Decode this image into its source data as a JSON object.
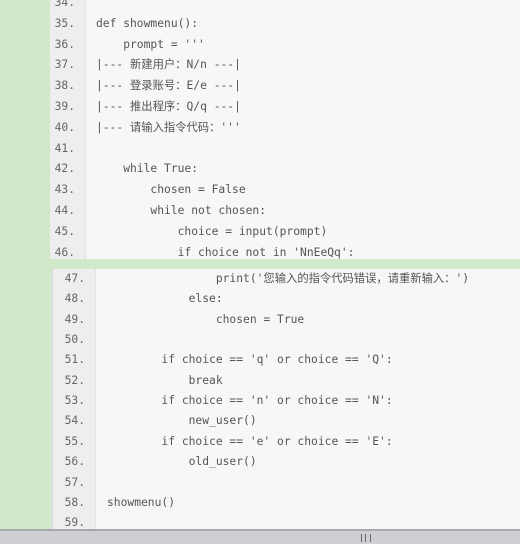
{
  "top_panel": {
    "lines": [
      {
        "n": "34.",
        "code": ""
      },
      {
        "n": "35.",
        "code": "def showmenu():"
      },
      {
        "n": "36.",
        "code": "    prompt = '''"
      },
      {
        "n": "37.",
        "code": "|--- 新建用户：N/n ---|"
      },
      {
        "n": "38.",
        "code": "|--- 登录账号：E/e ---|"
      },
      {
        "n": "39.",
        "code": "|--- 推出程序：Q/q ---|"
      },
      {
        "n": "40.",
        "code": "|--- 请输入指令代码：'''"
      },
      {
        "n": "41.",
        "code": ""
      },
      {
        "n": "42.",
        "code": "    while True:"
      },
      {
        "n": "43.",
        "code": "        chosen = False"
      },
      {
        "n": "44.",
        "code": "        while not chosen:"
      },
      {
        "n": "45.",
        "code": "            choice = input(prompt)"
      },
      {
        "n": "46.",
        "code": "            if choice not in 'NnEeQq':"
      }
    ]
  },
  "bottom_panel": {
    "lines": [
      {
        "n": "47.",
        "code": "                print('您输入的指令代码错误，请重新输入：')"
      },
      {
        "n": "48.",
        "code": "            else:"
      },
      {
        "n": "49.",
        "code": "                chosen = True"
      },
      {
        "n": "50.",
        "code": ""
      },
      {
        "n": "51.",
        "code": "        if choice == 'q' or choice == 'Q':"
      },
      {
        "n": "52.",
        "code": "            break"
      },
      {
        "n": "53.",
        "code": "        if choice == 'n' or choice == 'N':"
      },
      {
        "n": "54.",
        "code": "            new_user()"
      },
      {
        "n": "55.",
        "code": "        if choice == 'e' or choice == 'E':"
      },
      {
        "n": "56.",
        "code": "            old_user()"
      },
      {
        "n": "57.",
        "code": ""
      },
      {
        "n": "58.",
        "code": "showmenu()"
      },
      {
        "n": "59.",
        "code": ""
      }
    ]
  },
  "colors": {
    "background": "#d1e9c9",
    "code_bg": "#f7f7f7",
    "gutter": "#eeeeee",
    "text": "#555555"
  }
}
